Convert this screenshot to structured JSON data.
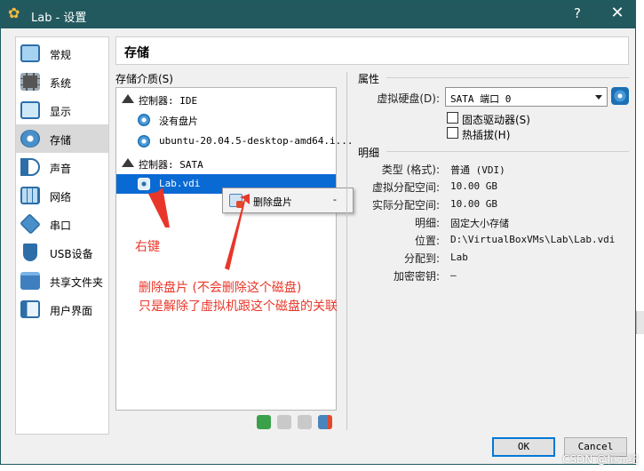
{
  "window": {
    "title": "Lab - 设置",
    "help": "?",
    "close": "✕"
  },
  "nav": {
    "items": [
      {
        "label": "常规",
        "icon": "monitor-icon"
      },
      {
        "label": "系统",
        "icon": "chip-icon"
      },
      {
        "label": "显示",
        "icon": "display-icon"
      },
      {
        "label": "存储",
        "icon": "storage-disk-icon",
        "selected": true
      },
      {
        "label": "声音",
        "icon": "speaker-icon"
      },
      {
        "label": "网络",
        "icon": "network-icon"
      },
      {
        "label": "串口",
        "icon": "serial-port-icon"
      },
      {
        "label": "USB设备",
        "icon": "usb-icon"
      },
      {
        "label": "共享文件夹",
        "icon": "shared-folder-icon"
      },
      {
        "label": "用户界面",
        "icon": "user-interface-icon"
      }
    ]
  },
  "header": {
    "title": "存储"
  },
  "storage": {
    "media_label": "存储介质(S)",
    "tree": [
      {
        "text": "控制器: IDE",
        "kind": "controller"
      },
      {
        "text": "没有盘片",
        "kind": "optical"
      },
      {
        "text": "ubuntu-20.04.5-desktop-amd64.i...",
        "kind": "optical"
      },
      {
        "text": "控制器: SATA",
        "kind": "controller"
      },
      {
        "text": "Lab.vdi",
        "kind": "harddisk",
        "selected": true
      }
    ],
    "toolbar_icons": [
      "add-controller-icon",
      "remove-controller-icon",
      "add-attachment-icon",
      "remove-attachment-icon"
    ]
  },
  "context_menu": {
    "item_label": "删除盘片",
    "shortcut": "-"
  },
  "annotations": {
    "right_click": "右键",
    "line1": "删除盘片 (不会删除这个磁盘)",
    "line2": "只是解除了虚拟机跟这个磁盘的关联"
  },
  "attributes": {
    "section": "属性",
    "hard_disk_label": "虚拟硬盘(D):",
    "hard_disk_value": "SATA 端口 0",
    "ssd_label": "固态驱动器(S)",
    "ssd_checked": false,
    "hotplug_label": "热插拔(H)",
    "hotplug_checked": false
  },
  "details": {
    "section": "明细",
    "rows": [
      {
        "label": "类型 (格式):",
        "value": "普通 (VDI)"
      },
      {
        "label": "虚拟分配空间:",
        "value": "10.00 GB"
      },
      {
        "label": "实际分配空间:",
        "value": "10.00 GB"
      },
      {
        "label": "明细:",
        "value": "固定大小存储"
      },
      {
        "label": "位置:",
        "value": "D:\\VirtualBoxVMs\\Lab\\Lab.vdi"
      },
      {
        "label": "分配到:",
        "value": "Lab"
      },
      {
        "label": "加密密钥:",
        "value": "—"
      }
    ]
  },
  "buttons": {
    "ok": "OK",
    "cancel": "Cancel"
  },
  "background": {
    "partial_char": "存"
  },
  "watermark": "CSDN @恒元纪",
  "colors": {
    "titlebar": "#22595e",
    "selection": "#0a6ad4",
    "annotation": "#e8372a"
  }
}
